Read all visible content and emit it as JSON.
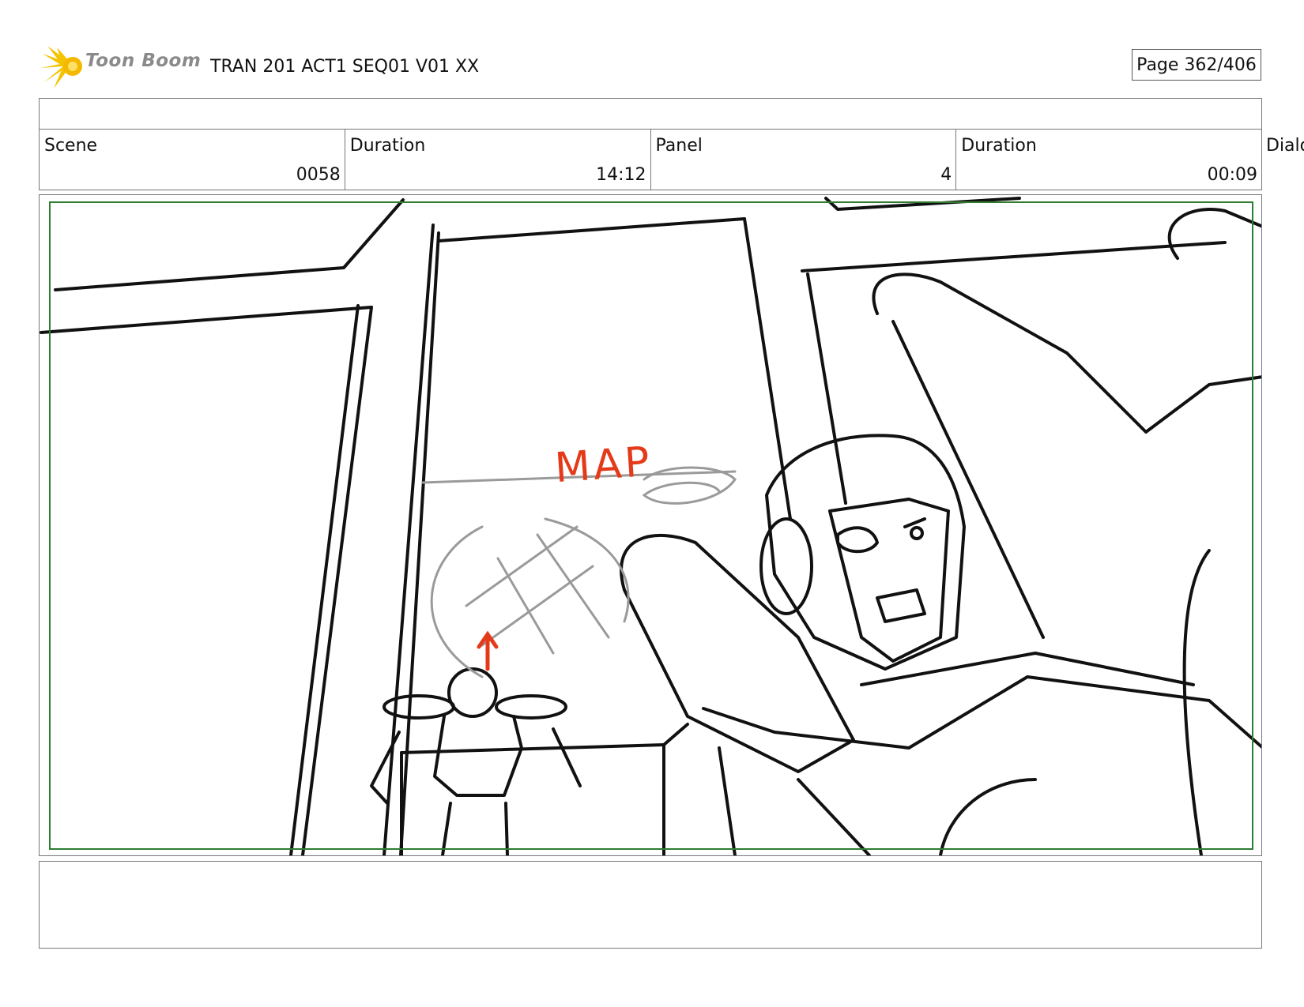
{
  "header": {
    "logo_text": "Toon Boom",
    "project_title": "TRAN 201 ACT1 SEQ01 V01 XX",
    "page_indicator": "Page 362/406"
  },
  "info": {
    "scene_label": "Scene",
    "scene_value": "0058",
    "scene_duration_label": "Duration",
    "scene_duration_value": "14:12",
    "panel_label": "Panel",
    "panel_value": "4",
    "panel_duration_label": "Duration",
    "panel_duration_value": "00:09",
    "dialog_label_clipped": "Dialo"
  },
  "panel": {
    "annotation_text": "MAP"
  },
  "colors": {
    "safe_frame": "#2e7d32",
    "annotation_red": "#e53a1a",
    "sketch_gray": "#9a9a9a",
    "logo_yellow": "#f5c400"
  }
}
